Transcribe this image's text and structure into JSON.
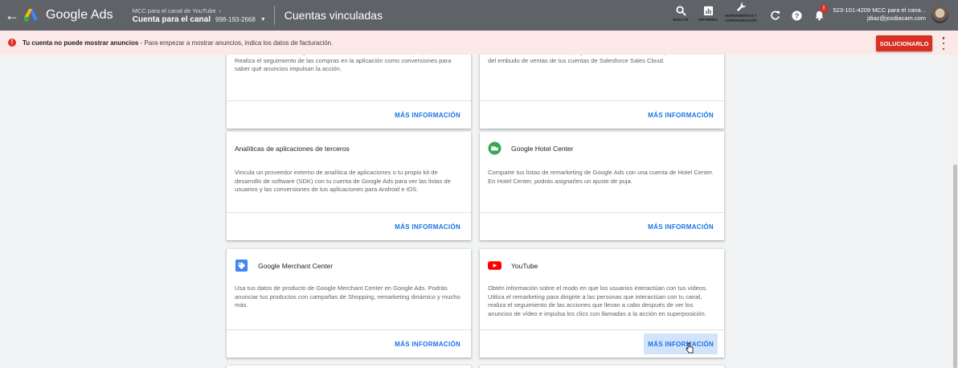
{
  "topbar": {
    "back_icon": "arrow-back-icon",
    "logo_text": "Google Ads",
    "account_parent": "MCC para el canal de YouTube",
    "account_name": "Cuenta para el canal",
    "account_id": "998-193-2668",
    "page_title": "Cuentas vinculadas",
    "tools": [
      {
        "icon": "search-icon",
        "label": "BUSCAR"
      },
      {
        "icon": "reports-icon",
        "label": "INFORMES"
      },
      {
        "icon": "wrench-icon",
        "label": "HERRAMIENTAS Y CONFIGURACIÓN"
      }
    ],
    "notification_badge": "!",
    "user_line1": "523-101-4209 MCC para el cana...",
    "user_line2": "jdiaz@josdiacam.com"
  },
  "banner": {
    "bold": "Tu cuenta no puede mostrar anuncios",
    "text": " - Para empezar a mostrar anuncios, indica los datos de facturación.",
    "action": "SOLUCIONARLO",
    "color": "#d93025"
  },
  "cards": [
    {
      "title": "",
      "desc": "Crea listas de remarketing en función de los usuarios actuales de la aplicación. Realiza el seguimiento de las compras en la aplicación como conversiones para saber qué anuncios impulsan la acción.",
      "more": "MÁS INFORMACIÓN"
    },
    {
      "title": "",
      "desc": "Mide las conversiones offline que generan tus anuncios online importando los datos del embudo de ventas de tus cuentas de Salesforce Sales Cloud.",
      "more": "MÁS INFORMACIÓN"
    },
    {
      "title": "Analíticas de aplicaciones de terceros",
      "desc": "Vincula un proveedor externo de analítica de aplicaciones o tu propio kit de desarrollo de software (SDK) con tu cuenta de Google Ads para ver las listas de usuarios y las conversiones de tus aplicaciones para Android e iOS.",
      "more": "MÁS INFORMACIÓN"
    },
    {
      "title": "Google Hotel Center",
      "desc": "Comparte tus listas de remarketing de Google Ads con una cuenta de Hotel Center. En Hotel Center, podrás asignarles un ajuste de puja.",
      "more": "MÁS INFORMACIÓN"
    },
    {
      "title": "Google Merchant Center",
      "desc": "Usa tus datos de producto de Google Merchant Center en Google Ads. Podrás anunciar tus productos con campañas de Shopping, remarketing dinámico y mucho más.",
      "more": "MÁS INFORMACIÓN"
    },
    {
      "title": "YouTube",
      "desc": "Obtén información sobre el modo en que los usuarios interactúan con tus vídeos. Utiliza el remarketing para dirigirte a las personas que interactúan con tu canal, realiza el seguimiento de las acciones que llevan a cabo después de ver los anuncios de vídeo e impulsa los clics con llamadas a la acción en superposición.",
      "more": "MÁS INFORMACIÓN"
    }
  ]
}
